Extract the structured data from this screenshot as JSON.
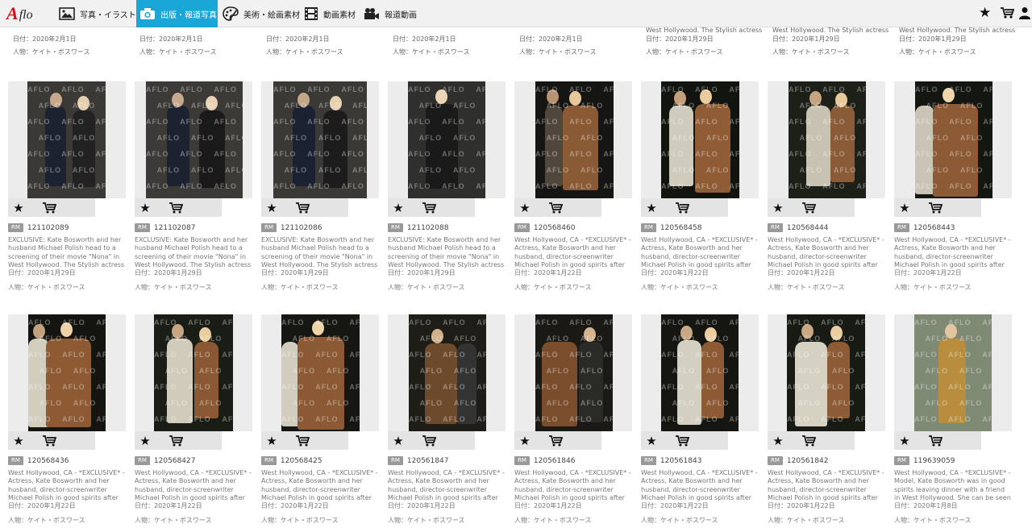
{
  "header": {
    "logo_mark": "A",
    "logo_text": "flo",
    "nav": [
      {
        "label": "写真・イラスト"
      },
      {
        "label": "出版・報道写真"
      },
      {
        "label": "美術・絵画素材"
      },
      {
        "label": "動画素材"
      },
      {
        "label": "報道動画"
      }
    ]
  },
  "top_row": [
    {
      "caption": "",
      "date": "日付：2020年2月1日",
      "person": "人物：ケイト・ボスワース"
    },
    {
      "caption": "",
      "date": "日付：2020年2月1日",
      "person": "人物：ケイト・ボスワース"
    },
    {
      "caption": "",
      "date": "日付：2020年2月1日",
      "person": "人物：ケイト・ボスワース"
    },
    {
      "caption": "",
      "date": "日付：2020年2月1日",
      "person": "人物：ケイト・ボスワース"
    },
    {
      "caption": "",
      "date": "日付：2020年2月1日",
      "person": "人物：ケイト・ボスワース"
    },
    {
      "caption": "West Hollywood. The Stylish actress",
      "date": "日付：2020年1月29日",
      "person": "人物：ケイト・ボスワース"
    },
    {
      "caption": "West Hollywood. The Stylish actress",
      "date": "日付：2020年1月29日",
      "person": "人物：ケイト・ボスワース"
    },
    {
      "caption": "West Hollywood. The Stylish actress",
      "date": "日付：2020年1月29日",
      "person": "人物：ケイト・ボスワース"
    }
  ],
  "watermark": "AFLO",
  "license_badge": "RM",
  "rows": [
    [
      {
        "id": "121102089",
        "desc": "EXCLUSIVE: Kate Bosworth and her husband Michael Polish head to a screening of their movie \"Nona\" in West Hollywood. The Stylish actress",
        "date": "日付：2020年1月29日",
        "person": "人物：ケイト・ボスワース"
      },
      {
        "id": "121102087",
        "desc": "EXCLUSIVE: Kate Bosworth and her husband Michael Polish head to a screening of their movie \"Nona\" in West Hollywood. The Stylish actress",
        "date": "日付：2020年1月29日",
        "person": "人物：ケイト・ボスワース"
      },
      {
        "id": "121102086",
        "desc": "EXCLUSIVE: Kate Bosworth and her husband Michael Polish head to a screening of their movie \"Nona\" in West Hollywood. The Stylish actress",
        "date": "日付：2020年1月29日",
        "person": "人物：ケイト・ボスワース"
      },
      {
        "id": "121102088",
        "desc": "EXCLUSIVE: Kate Bosworth and her husband Michael Polish head to a screening of their movie \"Nona\" in West Hollywood. The Stylish actress",
        "date": "日付：2020年1月29日",
        "person": "人物：ケイト・ボスワース"
      },
      {
        "id": "120568460",
        "desc": "West Hollywood, CA - *EXCLUSIVE* - Actress, Kate Bosworth and her husband, director-screenwriter Michael Polish in good spirits after",
        "date": "日付：2020年1月22日",
        "person": "人物：ケイト・ボスワース"
      },
      {
        "id": "120568458",
        "desc": "West Hollywood, CA - *EXCLUSIVE* - Actress, Kate Bosworth and her husband, director-screenwriter Michael Polish in good spirits after",
        "date": "日付：2020年1月22日",
        "person": "人物：ケイト・ボスワース"
      },
      {
        "id": "120568444",
        "desc": "West Hollywood, CA - *EXCLUSIVE* - Actress, Kate Bosworth and her husband, director-screenwriter Michael Polish in good spirits after",
        "date": "日付：2020年1月22日",
        "person": "人物：ケイト・ボスワース"
      },
      {
        "id": "120568443",
        "desc": "West Hollywood, CA - *EXCLUSIVE* - Actress, Kate Bosworth and her husband, director-screenwriter Michael Polish in good spirits after",
        "date": "日付：2020年1月22日",
        "person": "人物：ケイト・ボスワース"
      }
    ],
    [
      {
        "id": "120568436",
        "desc": "West Hollywood, CA - *EXCLUSIVE* - Actress, Kate Bosworth and her husband, director-screenwriter Michael Polish in good spirits after",
        "date": "日付：2020年1月22日",
        "person": "人物：ケイト・ボスワース"
      },
      {
        "id": "120568427",
        "desc": "West Hollywood, CA - *EXCLUSIVE* - Actress, Kate Bosworth and her husband, director-screenwriter Michael Polish in good spirits after",
        "date": "日付：2020年1月22日",
        "person": "人物：ケイト・ボスワース"
      },
      {
        "id": "120568425",
        "desc": "West Hollywood, CA - *EXCLUSIVE* - Actress, Kate Bosworth and her husband, director-screenwriter Michael Polish in good spirits after",
        "date": "日付：2020年1月22日",
        "person": "人物：ケイト・ボスワース"
      },
      {
        "id": "120561847",
        "desc": "West Hollywood, CA - *EXCLUSIVE* - Actress, Kate Bosworth and her husband, director-screenwriter Michael Polish in good spirits after",
        "date": "日付：2020年1月22日",
        "person": "人物：ケイト・ボスワース"
      },
      {
        "id": "120561846",
        "desc": "West Hollywood, CA - *EXCLUSIVE* - Actress, Kate Bosworth and her husband, director-screenwriter Michael Polish in good spirits after",
        "date": "日付：2020年1月22日",
        "person": "人物：ケイト・ボスワース"
      },
      {
        "id": "120561843",
        "desc": "West Hollywood, CA - *EXCLUSIVE* - Actress, Kate Bosworth and her husband, director-screenwriter Michael Polish in good spirits after",
        "date": "日付：2020年1月22日",
        "person": "人物：ケイト・ボスワース"
      },
      {
        "id": "120561842",
        "desc": "West Hollywood, CA - *EXCLUSIVE* - Actress, Kate Bosworth and her husband, director-screenwriter Michael Polish in good spirits after",
        "date": "日付：2020年1月22日",
        "person": "人物：ケイト・ボスワース"
      },
      {
        "id": "119639059",
        "desc": "West Hollywood, CA - *EXCLUSIVE* - Model, Kate Bosworth was in good spirits leaving dinner with a friend in West Hollywood. She can be seen",
        "date": "日付：2020年1月8日",
        "person": "人物：ケイト・ボスワース"
      }
    ]
  ]
}
